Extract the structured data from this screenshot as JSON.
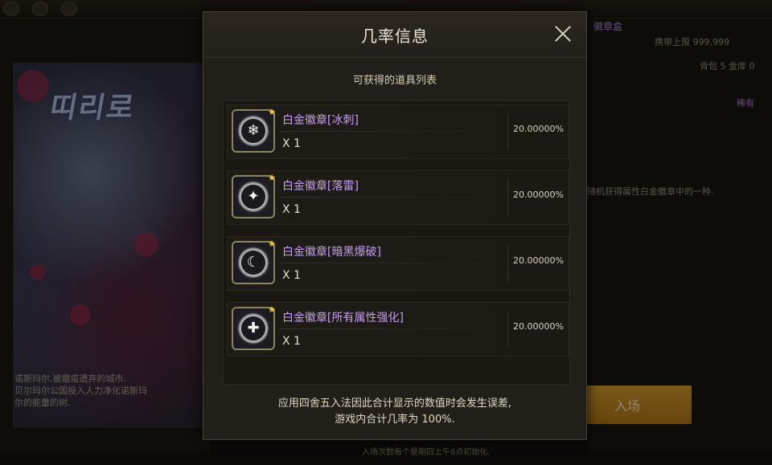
{
  "modal": {
    "title": "几率信息",
    "list_title": "可获得的道具列表",
    "items": [
      {
        "name": "白金徽章[冰刺]",
        "qty": "X 1",
        "rate": "20.00000%",
        "icon": "ice-spike-icon",
        "glyph": "❄"
      },
      {
        "name": "白金徽章[落雷]",
        "qty": "X 1",
        "rate": "20.00000%",
        "icon": "lightning-star-icon",
        "glyph": "✦"
      },
      {
        "name": "白金徽章[暗黑爆破]",
        "qty": "X 1",
        "rate": "20.00000%",
        "icon": "dark-moon-icon",
        "glyph": "☾"
      },
      {
        "name": "白金徽章[所有属性强化]",
        "qty": "X 1",
        "rate": "20.00000%",
        "icon": "all-element-icon",
        "glyph": "✚"
      }
    ],
    "footer_line1": "应用四舍五入法因此合计显示的数值时会发生误差,",
    "footer_line2": "游戏内合计几率为 100%."
  },
  "background": {
    "art_logo": "띠리로",
    "art_desc_line1": "诺斯玛尔,被瘟疫遗弃的城市.",
    "art_desc_line2": "贝尔玛尔公国投入人力净化诺斯玛",
    "art_desc_line3": "尔的能量的树.",
    "right_title": "徽章盒",
    "right_line1": "携带上限 999,999",
    "right_line2": "背包 5 金库 0",
    "right_tag": "稀有",
    "right_desc": "随机获得属性白金徽章中的一种.",
    "enter_label": "入场",
    "bottom_note": "入场次数每个星期四上午6点初始化."
  },
  "colors": {
    "accent_purple": "#c79ef5",
    "button_gold": "#d89a28",
    "modal_bg": "#221e19"
  }
}
